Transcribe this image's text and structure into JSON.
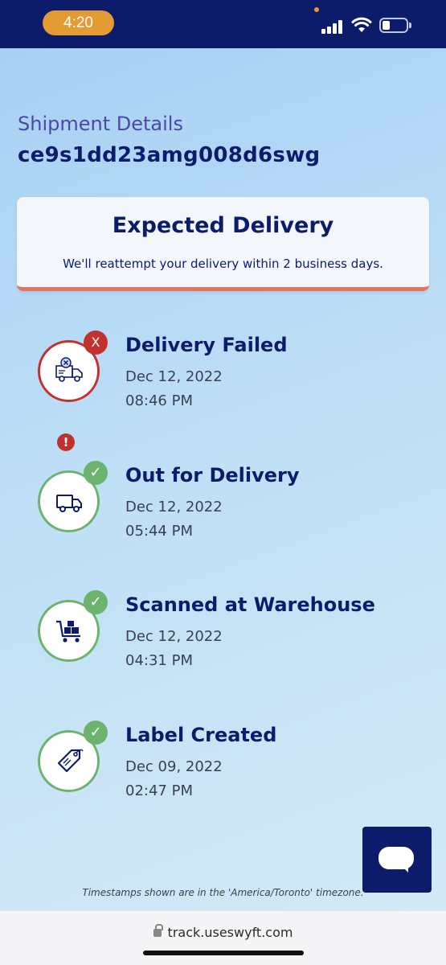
{
  "status_bar": {
    "time": "4:20"
  },
  "header": {
    "label": "Shipment Details",
    "tracking_number": "ce9s1dd23amg008d6swg"
  },
  "expected_delivery": {
    "title": "Expected Delivery",
    "message": "We'll reattempt your delivery within 2 business days."
  },
  "events": [
    {
      "title": "Delivery Failed",
      "date": "Dec 12, 2022",
      "time": "08:46 PM",
      "status": "failed",
      "badge": "X",
      "icon": "failed-delivery-truck-icon"
    },
    {
      "title": "Out for Delivery",
      "date": "Dec 12, 2022",
      "time": "05:44 PM",
      "status": "done",
      "badge": "✓",
      "icon": "delivery-truck-icon"
    },
    {
      "title": "Scanned at Warehouse",
      "date": "Dec 12, 2022",
      "time": "04:31 PM",
      "status": "done",
      "badge": "✓",
      "icon": "warehouse-cart-icon"
    },
    {
      "title": "Label Created",
      "date": "Dec 09, 2022",
      "time": "02:47 PM",
      "status": "done",
      "badge": "✓",
      "icon": "label-tag-icon"
    }
  ],
  "alert_glyph": "!",
  "timezone_note": "Timestamps shown are in the 'America/Toronto' timezone.",
  "browser": {
    "url": "track.useswyft.com"
  },
  "colors": {
    "navy": "#0d1b6b",
    "success_green": "#6cb36e",
    "error_red": "#c1322f",
    "card_accent": "#e2735f",
    "time_pill": "#e49b34"
  }
}
